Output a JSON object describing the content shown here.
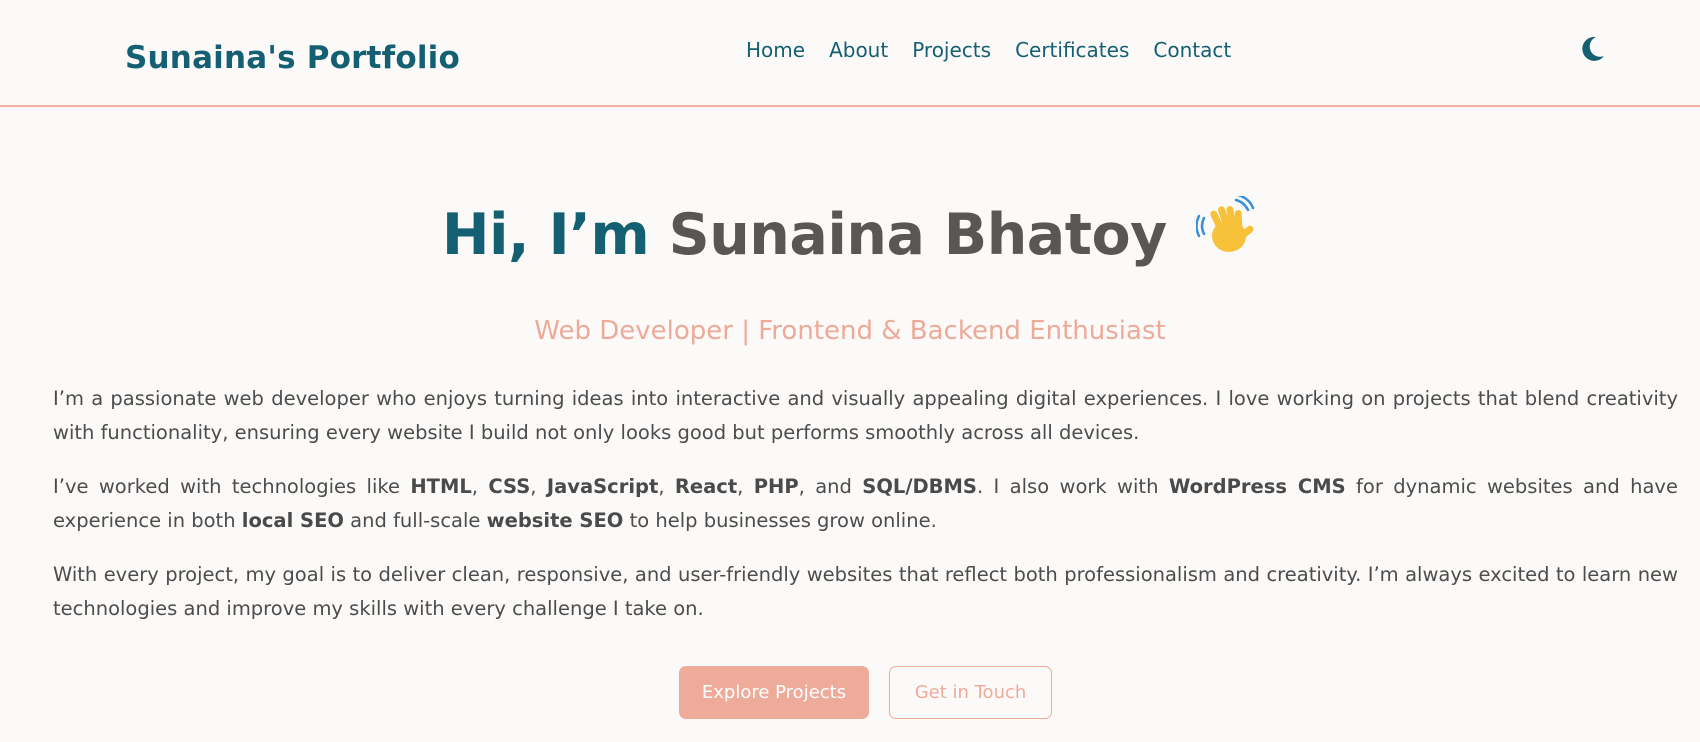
{
  "header": {
    "logo": "Sunaina's Portfolio",
    "nav": [
      {
        "label": "Home"
      },
      {
        "label": "About"
      },
      {
        "label": "Projects"
      },
      {
        "label": "Certificates"
      },
      {
        "label": "Contact"
      }
    ],
    "theme_toggle_icon": "moon-icon"
  },
  "hero": {
    "greeting": "Hi, I’m",
    "name": "Sunaina Bhatoy",
    "wave_icon": "waving-hand-icon",
    "subtitle": "Web Developer | Frontend & Backend Enthusiast"
  },
  "about": {
    "p1": "I’m a passionate web developer who enjoys turning ideas into interactive and visually appealing digital experiences. I love working on projects that blend creativity with functionality, ensuring every website I build not only looks good but performs smoothly across all devices.",
    "p2": {
      "t1": "I’ve worked with technologies like ",
      "html": "HTML",
      "sep1": ", ",
      "css": "CSS",
      "sep2": ", ",
      "js": "JavaScript",
      "sep3": ", ",
      "react": "React",
      "sep4": ", ",
      "php": "PHP",
      "sep5": ", and ",
      "sql": "SQL/DBMS",
      "t2": ". I also work with ",
      "wp": "WordPress CMS",
      "t3": " for dynamic websites and have experience in both ",
      "local_seo": "local SEO",
      "t4": " and full-scale ",
      "website_seo": "website SEO",
      "t5": " to help businesses grow online."
    },
    "p3": "With every project, my goal is to deliver clean, responsive, and user-friendly websites that reflect both professionalism and creativity. I’m always excited to learn new technologies and improve my skills with every challenge I take on."
  },
  "buttons": {
    "primary": "Explore Projects",
    "secondary": "Get in Touch"
  },
  "colors": {
    "brand": "#145f72",
    "accent": "#eeab9a",
    "background": "#fcfaf8"
  }
}
